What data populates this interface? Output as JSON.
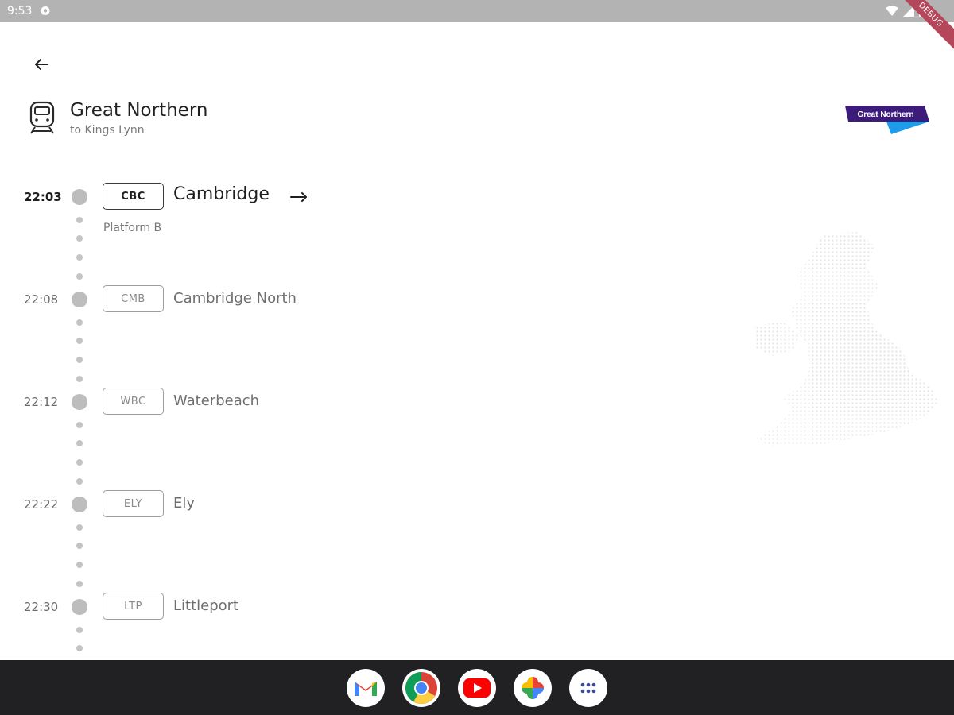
{
  "status_bar": {
    "time": "9:53",
    "debug_label": "DEBUG"
  },
  "header": {
    "operator": "Great Northern",
    "destination": "to Kings Lynn",
    "logo_text": "Great Northern"
  },
  "stops": [
    {
      "time": "22:03",
      "code": "CBC",
      "name": "Cambridge",
      "platform": "Platform B",
      "current": true
    },
    {
      "time": "22:08",
      "code": "CMB",
      "name": "Cambridge North",
      "current": false
    },
    {
      "time": "22:12",
      "code": "WBC",
      "name": "Waterbeach",
      "current": false
    },
    {
      "time": "22:22",
      "code": "ELY",
      "name": "Ely",
      "current": false
    },
    {
      "time": "22:30",
      "code": "LTP",
      "name": "Littleport",
      "current": false
    }
  ],
  "dock": {
    "apps": [
      "gmail-app",
      "chrome-app",
      "youtube-app",
      "photos-app",
      "app-drawer"
    ]
  },
  "colors": {
    "status_bar": "#b3b3b3",
    "dock": "#212124",
    "logo_purple": "#3d1b7a",
    "logo_blue": "#1e9bea",
    "dot": "#bdbdbd"
  }
}
